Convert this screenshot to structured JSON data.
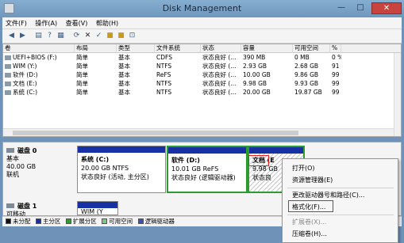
{
  "window": {
    "title": "Disk Management",
    "min": "—",
    "max": "□",
    "close": "✕"
  },
  "menu": [
    "文件(F)",
    "操作(A)",
    "查看(V)",
    "帮助(H)"
  ],
  "toolbar": [
    "back-icon",
    "forward-icon",
    "properties-icon",
    "help-icon",
    "refresh-icon",
    "delete-icon",
    "check-icon",
    "folder-open-icon",
    "folder-icon",
    "zoom-icon"
  ],
  "volumes": {
    "headers": [
      "卷",
      "布局",
      "类型",
      "文件系统",
      "状态",
      "容量",
      "可用空间",
      "%"
    ],
    "rows": [
      [
        "UEFI+BIOS (F:)",
        "简单",
        "基本",
        "CDFS",
        "状态良好 (...",
        "390 MB",
        "0 MB",
        "0 %"
      ],
      [
        "WIM (Y:)",
        "简单",
        "基本",
        "NTFS",
        "状态良好 (...",
        "2.93 GB",
        "2.68 GB",
        "91"
      ],
      [
        "软件 (D:)",
        "简单",
        "基本",
        "ReFS",
        "状态良好 (...",
        "10.00 GB",
        "9.86 GB",
        "99"
      ],
      [
        "文档 (E:)",
        "简单",
        "基本",
        "NTFS",
        "状态良好 (...",
        "9.98 GB",
        "9.93 GB",
        "99"
      ],
      [
        "系统 (C:)",
        "简单",
        "基本",
        "NTFS",
        "状态良好 (...",
        "20.00 GB",
        "19.87 GB",
        "99"
      ]
    ]
  },
  "disk0": {
    "name": "磁盘 0",
    "type": "基本",
    "size": "40.00 GB",
    "status": "联机",
    "partitions": [
      {
        "name": "系统  (C:)",
        "size": "20.00 GB NTFS",
        "status": "状态良好 (活动, 主分区)"
      },
      {
        "name": "软件  (D:)",
        "size": "10.01 GB ReFS",
        "status": "状态良好 (逻辑驱动器)"
      },
      {
        "name": "文档",
        "suffix": "(E",
        "size": "9.98 GB",
        "status": "状态良"
      }
    ]
  },
  "disk1": {
    "name": "磁盘 1",
    "type": "可移动",
    "partition": "WIM  (Y"
  },
  "legend": [
    "未分配",
    "主分区",
    "扩展分区",
    "可用空间",
    "逻辑驱动器"
  ],
  "colors": {
    "primary": "#1731a5",
    "extended": "#2e9b2e",
    "free": "#7cc87c",
    "logical": "#3a4fc0",
    "unallocated": "#111111",
    "highlight": "#e02020"
  },
  "context_menu": {
    "items": [
      "打开(O)",
      "资源管理器(E)",
      "更改驱动器号和路径(C)...",
      "格式化(F)...",
      "扩展卷(X)...",
      "压缩卷(H)..."
    ],
    "disabled": [
      false,
      false,
      false,
      false,
      true,
      false
    ]
  }
}
